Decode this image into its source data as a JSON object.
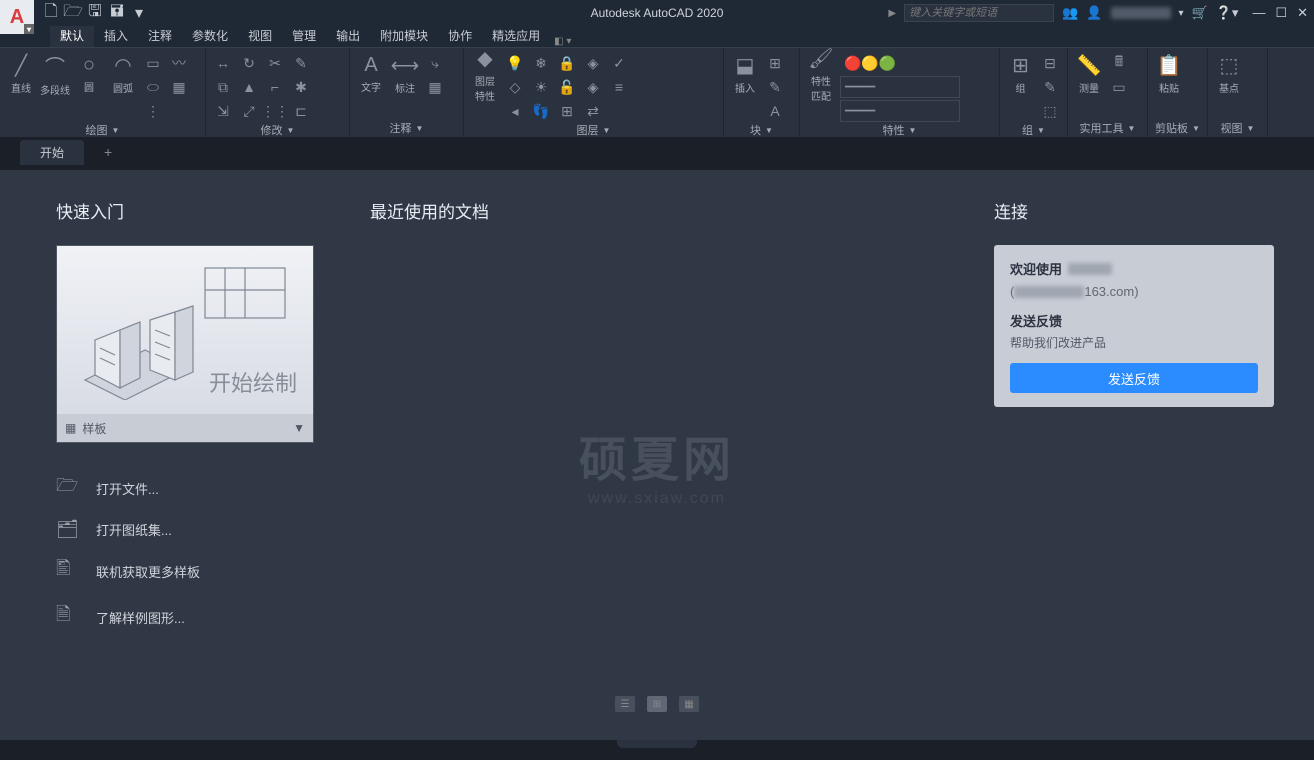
{
  "title": "Autodesk AutoCAD 2020",
  "search": {
    "placeholder": "键入关键字或短语"
  },
  "menuTabs": [
    "默认",
    "插入",
    "注释",
    "参数化",
    "视图",
    "管理",
    "输出",
    "附加模块",
    "协作",
    "精选应用"
  ],
  "activeTab": "默认",
  "ribbon": {
    "draw": {
      "title": "绘图",
      "line": "直线",
      "polyline": "多段线",
      "circle": "圆",
      "arc": "圆弧"
    },
    "modify": {
      "title": "修改"
    },
    "annotate": {
      "title": "注释",
      "text": "文字",
      "dim": "标注"
    },
    "layer": {
      "title": "图层",
      "props": "图层\n特性"
    },
    "block": {
      "title": "块",
      "insert": "插入"
    },
    "props": {
      "title": "特性",
      "match": "特性\n匹配"
    },
    "group": {
      "title": "组",
      "grp": "组"
    },
    "util": {
      "title": "实用工具",
      "measure": "测量"
    },
    "clip": {
      "title": "剪贴板",
      "paste": "粘贴"
    },
    "view": {
      "title": "视图",
      "base": "基点"
    }
  },
  "docTab": "开始",
  "start": {
    "quick": "快速入门",
    "recent": "最近使用的文档",
    "connect": "连接",
    "startDraw": "开始绘制",
    "template": "样板",
    "links": {
      "open": "打开文件...",
      "sheet": "打开图纸集...",
      "more": "联机获取更多样板",
      "sample": "了解样例图形..."
    }
  },
  "connectPanel": {
    "welcome": "欢迎使用",
    "emailSuffix": "163.com)",
    "sendHead": "发送反馈",
    "sendSub": "帮助我们改进产品",
    "sendBtn": "发送反馈"
  },
  "watermark": {
    "main": "硕夏网",
    "sub": "www.sxiaw.com"
  }
}
